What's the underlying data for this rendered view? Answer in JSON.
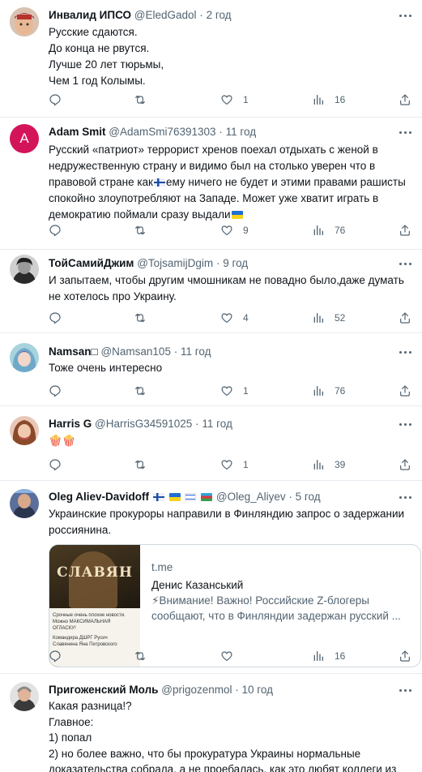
{
  "colors": {
    "text": "#0f1419",
    "secondary": "#536471",
    "border": "#e6ecf0"
  },
  "tweets": [
    {
      "name": "Инвалид ИПСО",
      "handle": "@EledGadol",
      "time": "2 год",
      "text": "Русские сдаются.\nДо конца не рвутся.\nЛучше 20 лет тюрьмы,\nЧем 1 год Колымы.",
      "likes": "1",
      "views": "16"
    },
    {
      "name": "Adam Smit",
      "handle": "@AdamSmi76391303",
      "time": "11 год",
      "avatar_letter": "A",
      "text_a": "Русский «патриот» террорист хренов поехал отдыхать с женой в\nнедружественную страну и видимо был на столько уверен что в\nправовой стране как",
      "text_b": "ему ничего не будет и этими правами рашисты\nспокойно злоупотребляют на Западе. Может уже хватит играть в\nдемократию поймали сразу выдали",
      "likes": "9",
      "views": "76"
    },
    {
      "name": "ТойСамийДжим",
      "handle": "@TojsamijDgim",
      "time": "9 год",
      "text": "И запытаем, чтобы другим чмошникам не повадно было,даже думать\nне хотелось про Украину.",
      "likes": "4",
      "views": "52"
    },
    {
      "name": "Namsan",
      "name_suffix": "□",
      "handle": "@Namsan105",
      "time": "11 год",
      "text": "Тоже очень интересно",
      "likes": "1",
      "views": "76"
    },
    {
      "name": "Harris G",
      "handle": "@HarrisG34591025",
      "time": "11 год",
      "text": "🍿🍿",
      "likes": "1",
      "views": "39"
    },
    {
      "name": "Oleg Aliev-Davidoff",
      "handle": "@Oleg_Aliyev",
      "time": "5 год",
      "text": "Украинские прокуроры направили в Финляндию запрос о задержании\nроссиянина.",
      "card": {
        "domain": "t.me",
        "title": "Денис Казанський",
        "desc_line1": "⚡Внимание! Важно! Российские Z-блогеры",
        "desc_line2": "сообщают, что в Финляндии задержан русский ...",
        "thumb_title": "СЛАВЯН",
        "thumb_caption1": "Срочные очень плохие новости.",
        "thumb_caption2": "Можно МАКСИМАЛЬНАЯ",
        "thumb_caption3": "ОГЛАСКУ!",
        "thumb_caption4": "Командира ДШРГ Русич",
        "thumb_caption5": "Славянина Яна Петровского"
      },
      "likes": "",
      "views": "16"
    },
    {
      "name": "Пригоженский Моль",
      "handle": "@prigozenmol",
      "time": "10 год",
      "text": "Какая разница!?\nГлавное:\n1) попал\n2) но более важно, что бы прокуратура Украины нормальные\nдоказательства собрала, а не проебалась, как это любят коллеги из рф."
    }
  ],
  "separator": "·"
}
